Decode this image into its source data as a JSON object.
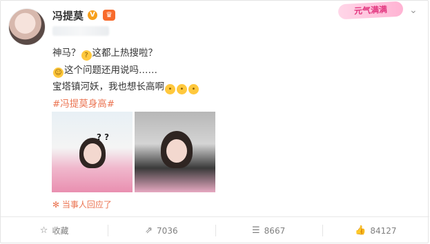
{
  "user": {
    "name": "冯提莫",
    "verified_mark": "V"
  },
  "badge_card": "元气满满",
  "post": {
    "line1": "神马？",
    "line1_after_emoji": "这都上热搜啦？",
    "line2": "这个问题还用说吗……",
    "line3": "宝塔镇河妖，我也想长高啊",
    "hashtag": "#冯提莫身高#",
    "photo1_marks": "? ?"
  },
  "reply_note": "当事人回应了",
  "footer": {
    "favorite_label": "收藏",
    "repost_count": "7036",
    "comment_count": "8667",
    "like_count": "84127"
  },
  "colors": {
    "accent": "#eb7350",
    "verified": "#f7a01c"
  }
}
